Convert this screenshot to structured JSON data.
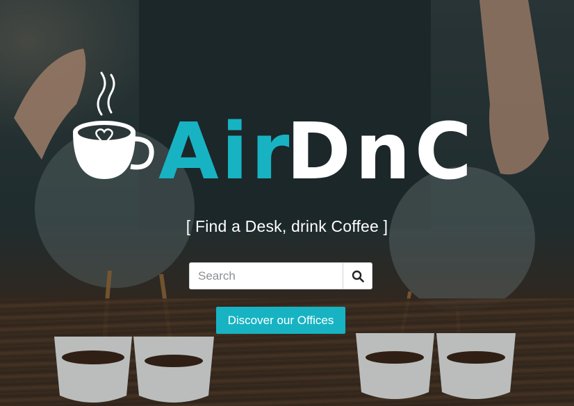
{
  "brand": {
    "name_part1": "Air",
    "name_part2": "DnC",
    "logo_icon": "coffee-cup-heart-icon",
    "color_part1": "#17b3c3",
    "color_part2": "#ffffff"
  },
  "hero": {
    "tagline": "[ Find a Desk, drink Coffee ]",
    "background": "coffee-pouring-photo"
  },
  "search": {
    "placeholder": "Search",
    "value": "",
    "button_icon": "search-icon"
  },
  "cta": {
    "label": "Discover our Offices",
    "color": "#17b3c3"
  }
}
